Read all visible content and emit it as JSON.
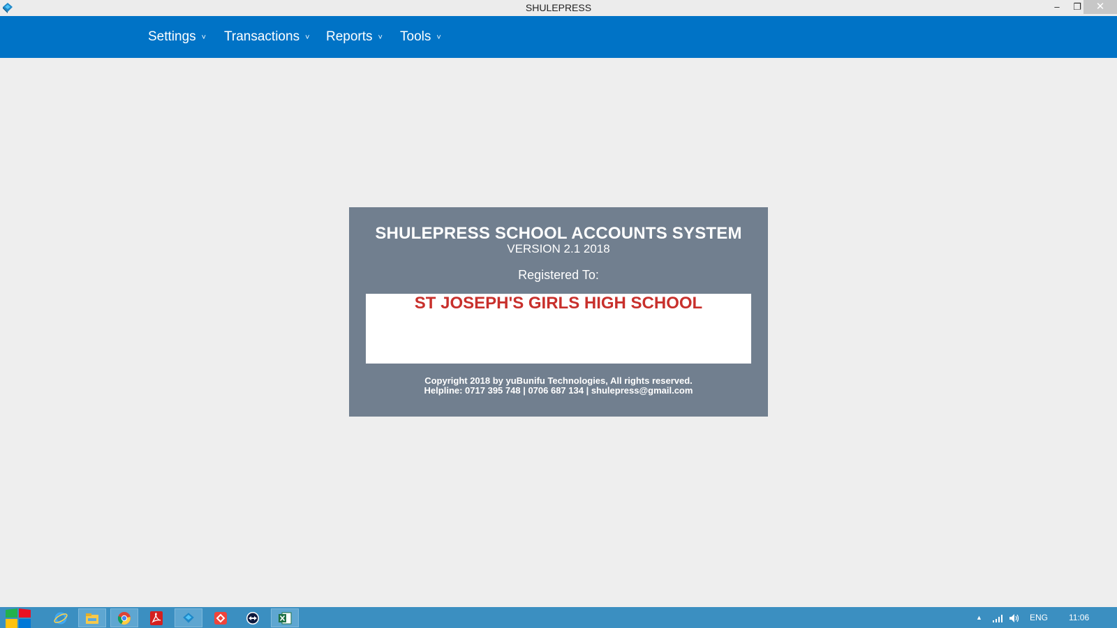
{
  "window": {
    "title": "SHULEPRESS",
    "minimize_glyph": "–",
    "maximize_glyph": "❐",
    "close_glyph": "✕"
  },
  "menu": {
    "items": [
      {
        "label": "Settings"
      },
      {
        "label": "Transactions"
      },
      {
        "label": "Reports"
      },
      {
        "label": "Tools"
      }
    ],
    "chevron": "˅"
  },
  "about": {
    "product_title": "SHULEPRESS SCHOOL ACCOUNTS SYSTEM",
    "version": "VERSION 2.1 2018",
    "registered_label": "Registered To:",
    "school_name": "ST JOSEPH'S GIRLS HIGH SCHOOL",
    "copyright": "Copyright 2018 by yuBunifu Technologies, All rights reserved.",
    "helpline": "Helpline: 0717 395 748 | 0706 687 134 | shulepress@gmail.com"
  },
  "taskbar": {
    "icons": [
      "internet-explorer-icon",
      "file-explorer-icon",
      "chrome-icon",
      "acrobat-icon",
      "shulepress-icon",
      "anydesk-icon",
      "teamviewer-icon",
      "excel-icon"
    ],
    "language": "ENG",
    "time": "11:06"
  },
  "colors": {
    "menubar": "#0073c6",
    "panel": "#717f8f",
    "school_name": "#c8302c",
    "taskbar": "#3b8fc1"
  }
}
